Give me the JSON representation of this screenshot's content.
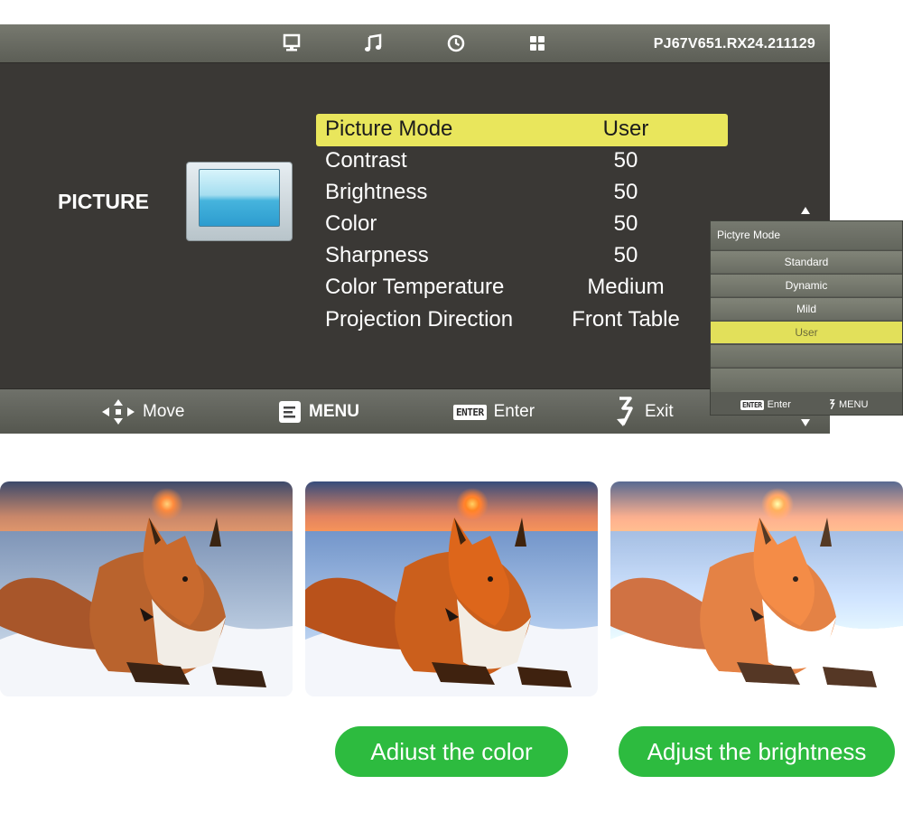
{
  "osd": {
    "top_bar": {
      "icons": [
        "picture-icon",
        "music-icon",
        "clock-icon",
        "apps-icon"
      ],
      "version": "PJ67V651.RX24.211129"
    },
    "section_label": "PICTURE",
    "menu": [
      {
        "label": "Picture Mode",
        "value": "User",
        "selected": true
      },
      {
        "label": "Contrast",
        "value": "50"
      },
      {
        "label": "Brightness",
        "value": "50"
      },
      {
        "label": "Color",
        "value": "50"
      },
      {
        "label": "Sharpness",
        "value": "50"
      },
      {
        "label": "Color Temperature",
        "value": "Medium"
      },
      {
        "label": "Projection Direction",
        "value": "Front Table"
      }
    ],
    "bottom_bar": {
      "move": "Move",
      "menu": "MENU",
      "enter_key": "ENTER",
      "enter": "Enter",
      "exit": "Exit"
    }
  },
  "popup": {
    "title": "Pictyre Mode",
    "options": [
      "Standard",
      "Dynamic",
      "Mild",
      "User"
    ],
    "selected": "User",
    "footer": {
      "enter_key": "ENTER",
      "enter": "Enter",
      "menu": "MENU"
    }
  },
  "captions": {
    "color": "Adiust the color",
    "brightness": "Adjust the brightness"
  },
  "colors": {
    "highlight": "#e9e65c",
    "osd_background": "#3a3835",
    "pill_green": "#2dbb3f"
  }
}
